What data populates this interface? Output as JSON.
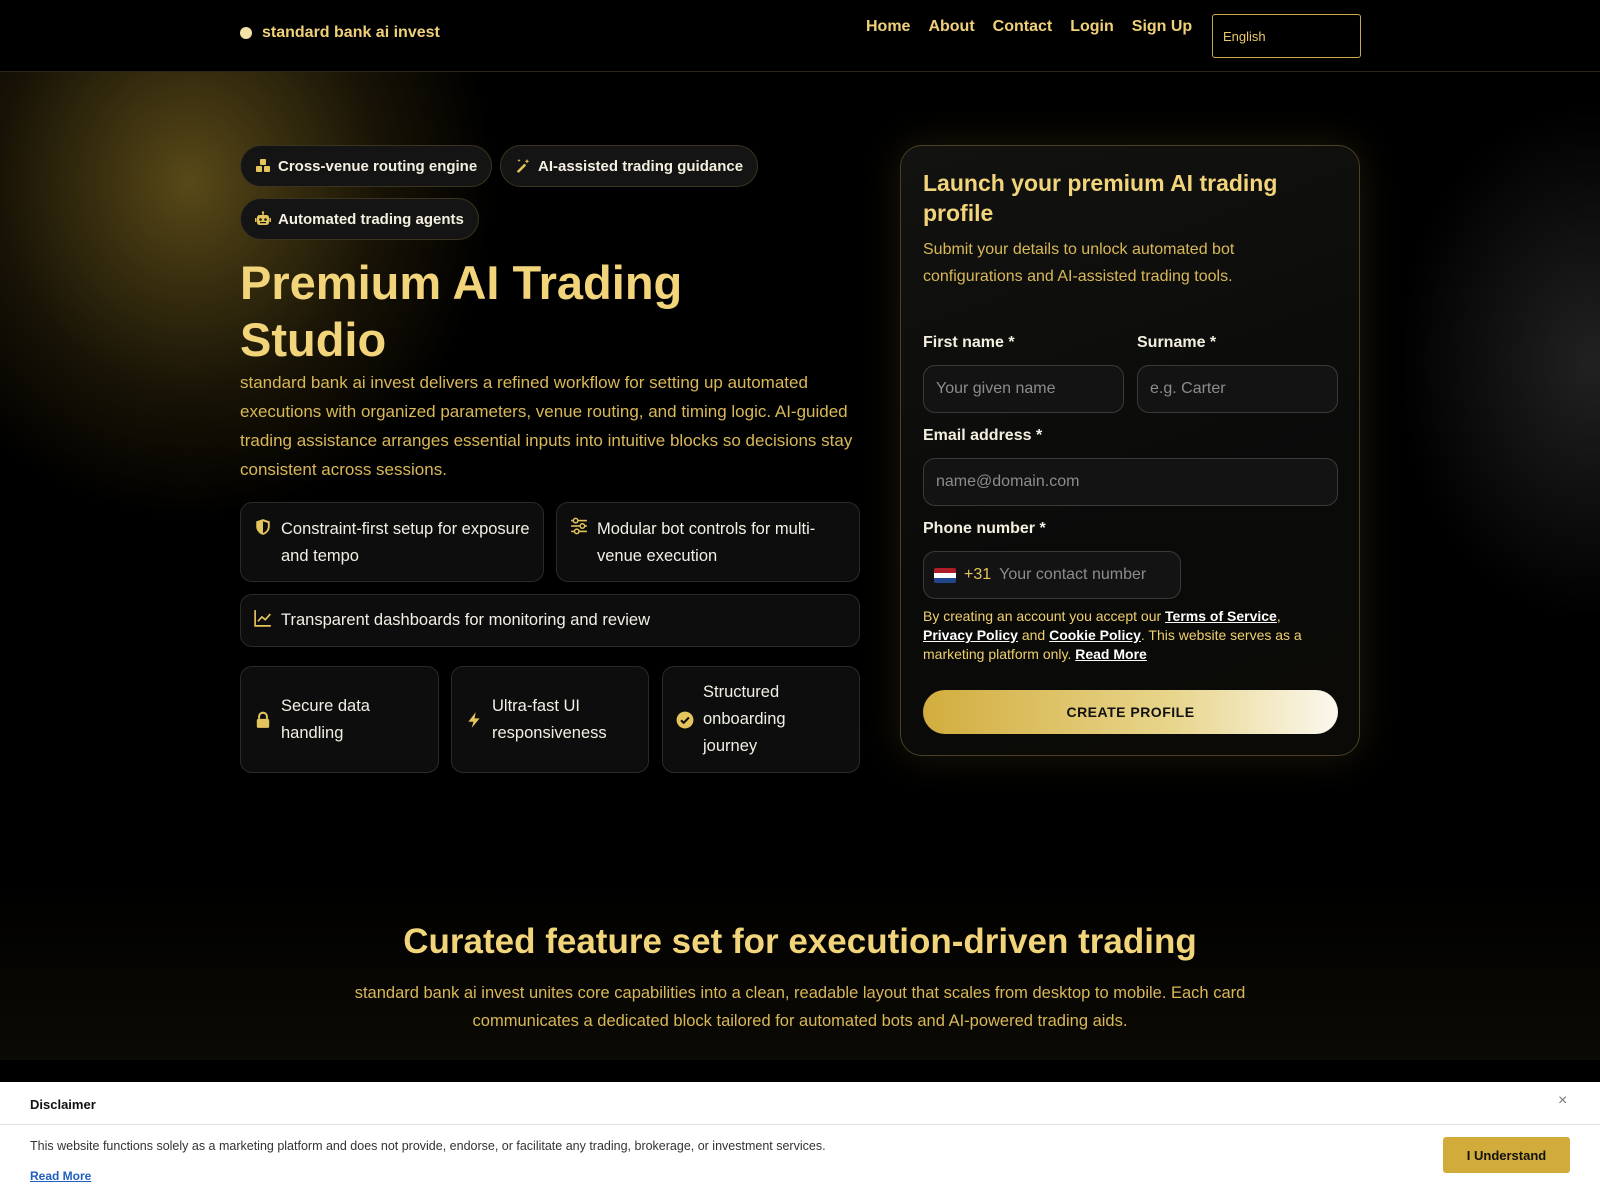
{
  "nav": {
    "brand": "standard bank ai invest",
    "links": [
      "Home",
      "About",
      "Contact",
      "Login",
      "Sign Up"
    ],
    "language": "English"
  },
  "hero": {
    "pills": [
      "Cross-venue routing engine",
      "AI-assisted trading guidance",
      "Automated trading agents"
    ],
    "title": "Premium AI Trading Studio",
    "description": "standard bank ai invest delivers a refined workflow for setting up automated executions with organized parameters, venue routing, and timing logic. AI-guided trading assistance arranges essential inputs into intuitive blocks so decisions stay consistent across sessions.",
    "features": [
      "Constraint-first setup for exposure and tempo",
      "Modular bot controls for multi-venue execution",
      "Transparent dashboards for monitoring and review"
    ],
    "highlights": [
      "Secure data handling",
      "Ultra-fast UI responsiveness",
      "Structured onboarding journey"
    ]
  },
  "form": {
    "title": "Launch your premium AI trading profile",
    "subtitle": "Submit your details to unlock automated bot configurations and AI-assisted trading tools.",
    "first_name_label": "First name *",
    "first_name_placeholder": "Your given name",
    "surname_label": "Surname *",
    "surname_placeholder": "e.g. Carter",
    "email_label": "Email address *",
    "email_placeholder": "name@domain.com",
    "phone_label": "Phone number *",
    "dial_code": "+31",
    "phone_placeholder": "Your contact number",
    "legal_prefix": "By creating an account you accept our ",
    "terms": "Terms of Service",
    "comma": ",",
    "privacy": "Privacy Policy",
    "and": " and ",
    "cookie": "Cookie Policy",
    "legal_suffix": ". This website serves as a marketing platform only. ",
    "read_more": "Read More",
    "submit": "CREATE PROFILE"
  },
  "section": {
    "title": "Curated feature set for execution-driven trading",
    "description": "standard bank ai invest unites core capabilities into a clean, readable layout that scales from desktop to mobile. Each card communicates a dedicated block tailored for automated bots and AI-powered trading aids."
  },
  "disclaimer": {
    "title": "Disclaimer",
    "close": "×",
    "text": "This website functions solely as a marketing platform and does not provide, endorse, or facilitate any trading, brokerage, or investment services.",
    "read_more": "Read More",
    "button": "I Understand"
  },
  "colors": {
    "accent": "#f2d47a",
    "flag_red": "#ae1c28",
    "flag_white": "#ffffff",
    "flag_blue": "#21468b"
  }
}
